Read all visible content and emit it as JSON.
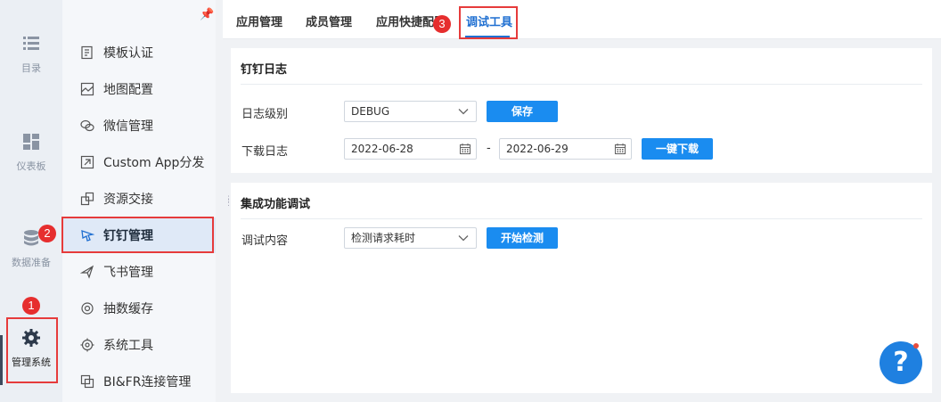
{
  "rail": {
    "items": [
      {
        "label": "目录",
        "icon": "list-icon"
      },
      {
        "label": "仪表板",
        "icon": "dashboard-icon"
      },
      {
        "label": "数据准备",
        "icon": "database-icon"
      },
      {
        "label": "管理系统",
        "icon": "gear-icon"
      }
    ]
  },
  "menu": {
    "items": [
      {
        "label": "模板认证",
        "icon": "template-icon"
      },
      {
        "label": "地图配置",
        "icon": "map-icon"
      },
      {
        "label": "微信管理",
        "icon": "wechat-icon"
      },
      {
        "label": "Custom App分发",
        "icon": "share-icon"
      },
      {
        "label": "资源交接",
        "icon": "handover-icon"
      },
      {
        "label": "钉钉管理",
        "icon": "dingtalk-icon"
      },
      {
        "label": "飞书管理",
        "icon": "feishu-icon"
      },
      {
        "label": "抽数缓存",
        "icon": "cache-icon"
      },
      {
        "label": "系统工具",
        "icon": "tool-icon"
      },
      {
        "label": "BI&FR连接管理",
        "icon": "link-icon"
      }
    ]
  },
  "tabs": [
    "应用管理",
    "成员管理",
    "应用快捷配置",
    "调试工具"
  ],
  "log_card": {
    "title": "钉钉日志",
    "level_label": "日志级别",
    "level_value": "DEBUG",
    "save_label": "保存",
    "download_label": "下载日志",
    "date_from": "2022-06-28",
    "date_sep": "-",
    "date_to": "2022-06-29",
    "download_btn": "一键下载"
  },
  "debug_card": {
    "title": "集成功能调试",
    "content_label": "调试内容",
    "content_value": "检测请求耗时",
    "start_label": "开始检测"
  },
  "annotations": [
    "1",
    "2",
    "3"
  ],
  "help": {
    "label": "?"
  },
  "colors": {
    "accent": "#1a8cf0",
    "annotation": "#e62e2e"
  }
}
